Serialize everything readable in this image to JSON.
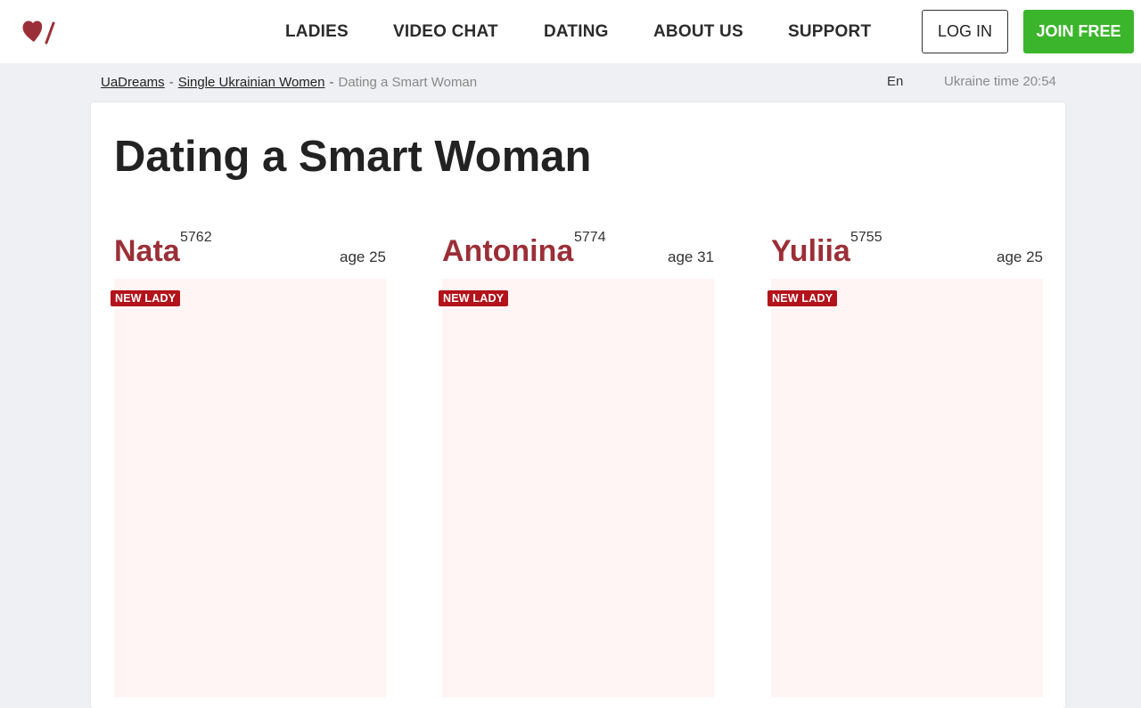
{
  "header": {
    "logo_icon": "heart-slash-logo-icon",
    "brand_color": "#9b2f37",
    "nav": [
      {
        "label": "LADIES"
      },
      {
        "label": "VIDEO CHAT"
      },
      {
        "label": "DATING"
      },
      {
        "label": "ABOUT US"
      },
      {
        "label": "SUPPORT"
      }
    ],
    "login_label": "LOG IN",
    "join_label": "JOIN FREE",
    "join_color": "#3bb52b"
  },
  "breadcrumb": {
    "items": [
      "UaDreams",
      "Single Ukrainian Women"
    ],
    "separator": "-",
    "current": "Dating a Smart Woman"
  },
  "lang": "En",
  "ukraine_time": "Ukraine time 20:54",
  "page_title": "Dating a Smart Woman",
  "ladies": [
    {
      "name": "Nata",
      "id": "5762",
      "age": "age 25",
      "badge": "NEW LADY"
    },
    {
      "name": "Antonina",
      "id": "5774",
      "age": "age 31",
      "badge": "NEW LADY"
    },
    {
      "name": "Yuliia",
      "id": "5755",
      "age": "age 25",
      "badge": "NEW LADY"
    }
  ],
  "badge_color": "#b3131b"
}
